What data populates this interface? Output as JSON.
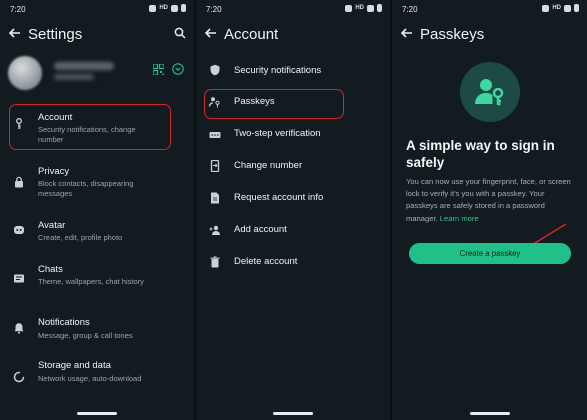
{
  "colors": {
    "accent": "#21c08a",
    "highlight": "#d2262b",
    "background": "#121b20"
  },
  "screen1": {
    "time": "7:20",
    "title": "Settings",
    "items": [
      {
        "label": "Account",
        "sub": "Security notifications, change number",
        "icon": "key-icon"
      },
      {
        "label": "Privacy",
        "sub": "Block contacts, disappearing messages",
        "icon": "lock-icon"
      },
      {
        "label": "Avatar",
        "sub": "Create, edit, profile photo",
        "icon": "avatar-face-icon"
      },
      {
        "label": "Chats",
        "sub": "Theme, wallpapers, chat history",
        "icon": "chat-icon"
      },
      {
        "label": "Notifications",
        "sub": "Message, group & call tones",
        "icon": "bell-icon"
      },
      {
        "label": "Storage and data",
        "sub": "Network usage, auto-download",
        "icon": "data-circle-icon"
      }
    ]
  },
  "screen2": {
    "time": "7:20",
    "title": "Account",
    "items": [
      {
        "label": "Security notifications",
        "icon": "shield-icon"
      },
      {
        "label": "Passkeys",
        "icon": "passkey-icon"
      },
      {
        "label": "Two-step verification",
        "icon": "dots-icon"
      },
      {
        "label": "Change number",
        "icon": "phone-swap-icon"
      },
      {
        "label": "Request account info",
        "icon": "document-icon"
      },
      {
        "label": "Add account",
        "icon": "add-person-icon"
      },
      {
        "label": "Delete account",
        "icon": "trash-icon"
      }
    ]
  },
  "screen3": {
    "time": "7:20",
    "title": "Passkeys",
    "heading": "A simple way to sign in safely",
    "body": "You can now use your fingerprint, face, or screen lock to verify it's you with a passkey. Your passkeys are safely stored in a password manager.",
    "learn_more": "Learn more",
    "cta": "Create a passkey"
  },
  "status": {
    "hd": "HD"
  }
}
